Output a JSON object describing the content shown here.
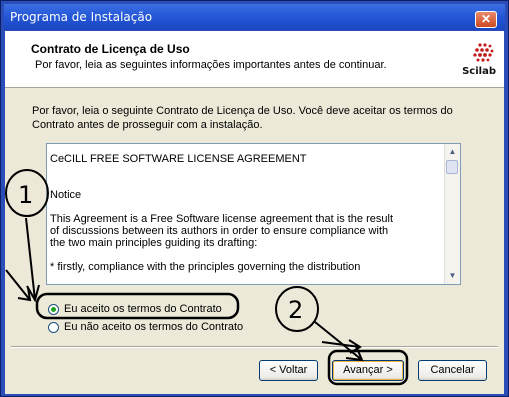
{
  "window": {
    "title": "Programa de Instalação",
    "close_glyph": "✕"
  },
  "header": {
    "title": "Contrato de Licença de Uso",
    "subtitle": "Por favor, leia as seguintes informações importantes antes de continuar.",
    "logo_text": "Scilab"
  },
  "intro": "Por favor, leia o seguinte Contrato de Licença de Uso. Você deve aceitar os termos do Contrato antes de prosseguir com a instalação.",
  "license": {
    "text": "CeCILL FREE SOFTWARE LICENSE AGREEMENT\n\n\n    Notice\n\nThis Agreement is a Free Software license agreement that is the result\nof discussions between its authors in order to ensure compliance with\nthe two main principles guiding its drafting:\n\n  * firstly, compliance with the principles governing the distribution"
  },
  "options": {
    "accept": {
      "label": "Eu aceito os termos do Contrato",
      "selected": true
    },
    "decline": {
      "label": "Eu não aceito os termos do Contrato",
      "selected": false
    }
  },
  "buttons": {
    "back": "< Voltar",
    "next": "Avançar >",
    "cancel": "Cancelar"
  },
  "annotations": {
    "label_1": "1",
    "label_2": "2"
  },
  "colors": {
    "titlebar": "#2458d8",
    "dialog_bg": "#ece9d8",
    "radio_dot": "#21a121"
  }
}
